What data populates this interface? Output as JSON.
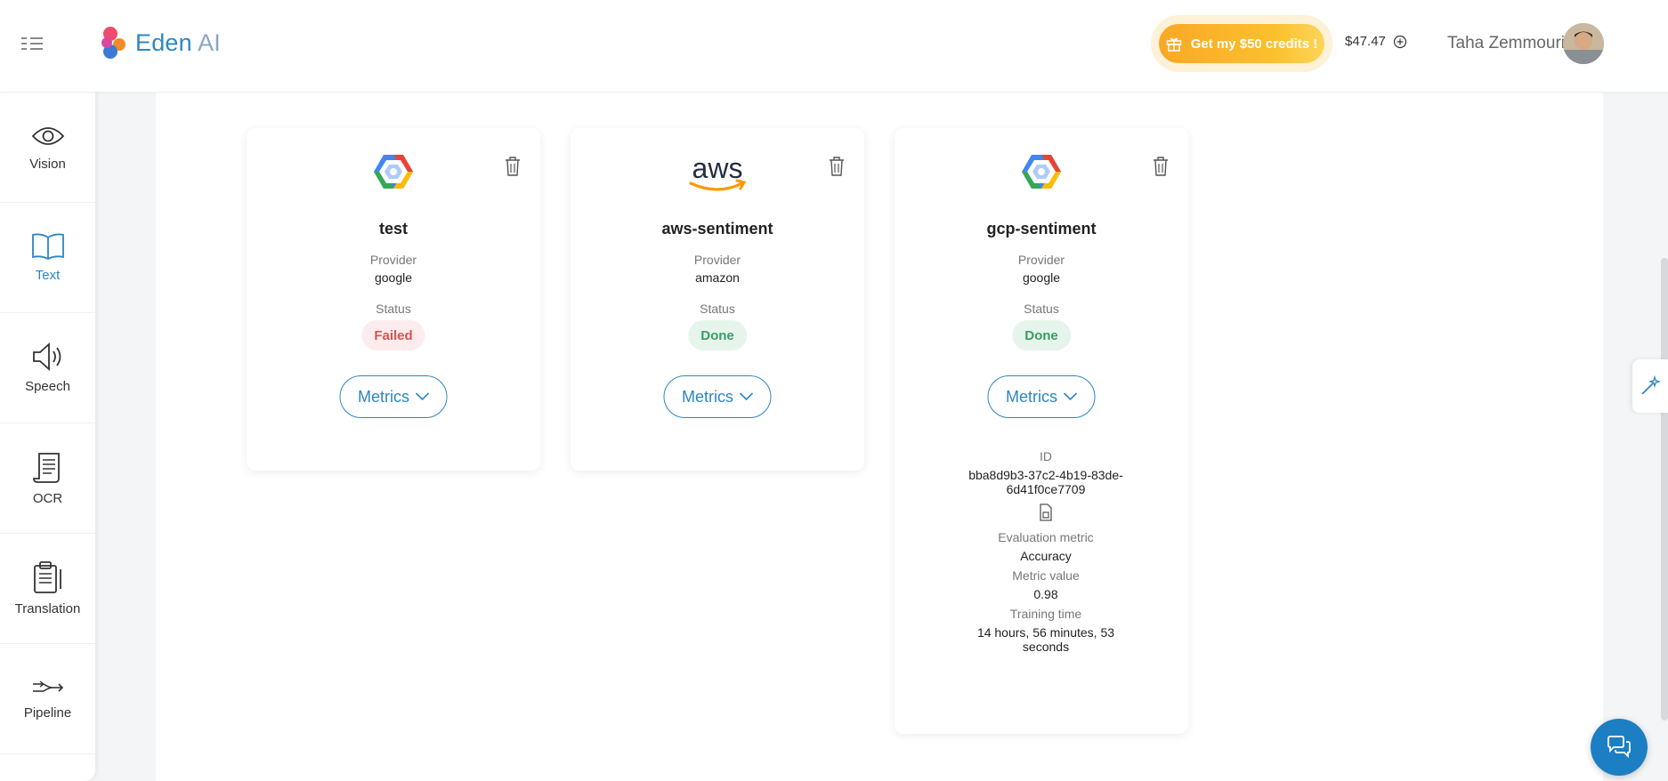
{
  "header": {
    "logo_name": "Eden",
    "logo_suffix": "AI",
    "credits_button": "Get my $50 credits !",
    "balance": "$47.47",
    "user_name": "Taha Zemmouri"
  },
  "sidebar": {
    "items": [
      {
        "label": "Vision",
        "icon": "eye-icon"
      },
      {
        "label": "Text",
        "icon": "book-icon",
        "active": true
      },
      {
        "label": "Speech",
        "icon": "speaker-icon"
      },
      {
        "label": "OCR",
        "icon": "scroll-document-icon"
      },
      {
        "label": "Translation",
        "icon": "clipboard-icon"
      },
      {
        "label": "Pipeline",
        "icon": "pipeline-icon"
      }
    ]
  },
  "labels": {
    "provider": "Provider",
    "status": "Status",
    "metrics": "Metrics"
  },
  "cards": [
    {
      "name": "test",
      "provider": "google",
      "status": "Failed",
      "logo": "google-cloud-logo"
    },
    {
      "name": "aws-sentiment",
      "provider": "amazon",
      "status": "Done",
      "logo": "aws-logo"
    },
    {
      "name": "gcp-sentiment",
      "provider": "google",
      "status": "Done",
      "logo": "google-cloud-logo",
      "details": {
        "id_label": "ID",
        "id_line1": "bba8d9b3-37c2-4b19-83de-",
        "id_line2": "6d41f0ce7709",
        "eval_label": "Evaluation metric",
        "eval_value": "Accuracy",
        "metric_value_label": "Metric value",
        "metric_value": "0.98",
        "training_label": "Training time",
        "training_line1": "14 hours, 56 minutes, 53",
        "training_line2": "seconds"
      }
    }
  ],
  "colors": {
    "accent": "#2e86c1",
    "credits": "#f9a825",
    "failed": "#d9534f",
    "done": "#3a9c63"
  }
}
